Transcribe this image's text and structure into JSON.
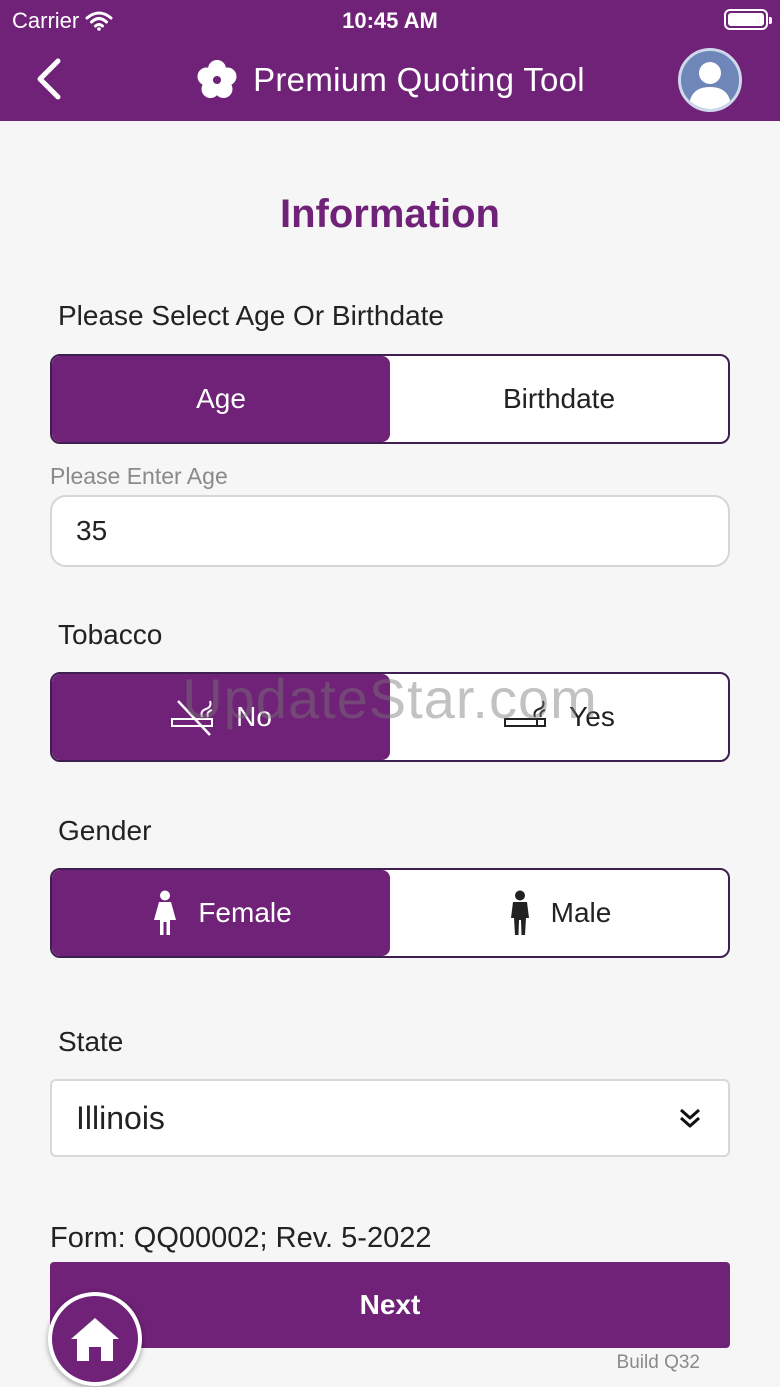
{
  "status_bar": {
    "carrier": "Carrier",
    "time": "10:45 AM"
  },
  "header": {
    "title": "Premium Quoting Tool",
    "back_icon": "chevron-left-icon",
    "logo_icon": "flower-icon",
    "avatar_icon": "user-avatar-icon"
  },
  "page": {
    "title": "Information"
  },
  "age_section": {
    "label": "Please Select Age Or Birthdate",
    "options": [
      "Age",
      "Birthdate"
    ],
    "selected": "Age",
    "input_caption": "Please Enter Age",
    "input_value": "35"
  },
  "tobacco_section": {
    "label": "Tobacco",
    "options": [
      "No",
      "Yes"
    ],
    "selected": "No",
    "icons": [
      "no-smoking-icon",
      "smoking-icon"
    ]
  },
  "gender_section": {
    "label": "Gender",
    "options": [
      "Female",
      "Male"
    ],
    "selected": "Female",
    "icons": [
      "female-icon",
      "male-icon"
    ]
  },
  "state_section": {
    "label": "State",
    "value": "Illinois",
    "icon": "double-chevron-down-icon"
  },
  "footer": {
    "form_info": "Form: QQ00002; Rev. 5-2022",
    "next_label": "Next",
    "build": "Build Q32",
    "home_icon": "home-icon"
  },
  "watermark": "UpdateStar.com",
  "colors": {
    "brand": "#6f2277",
    "background": "#f6f6f6"
  }
}
